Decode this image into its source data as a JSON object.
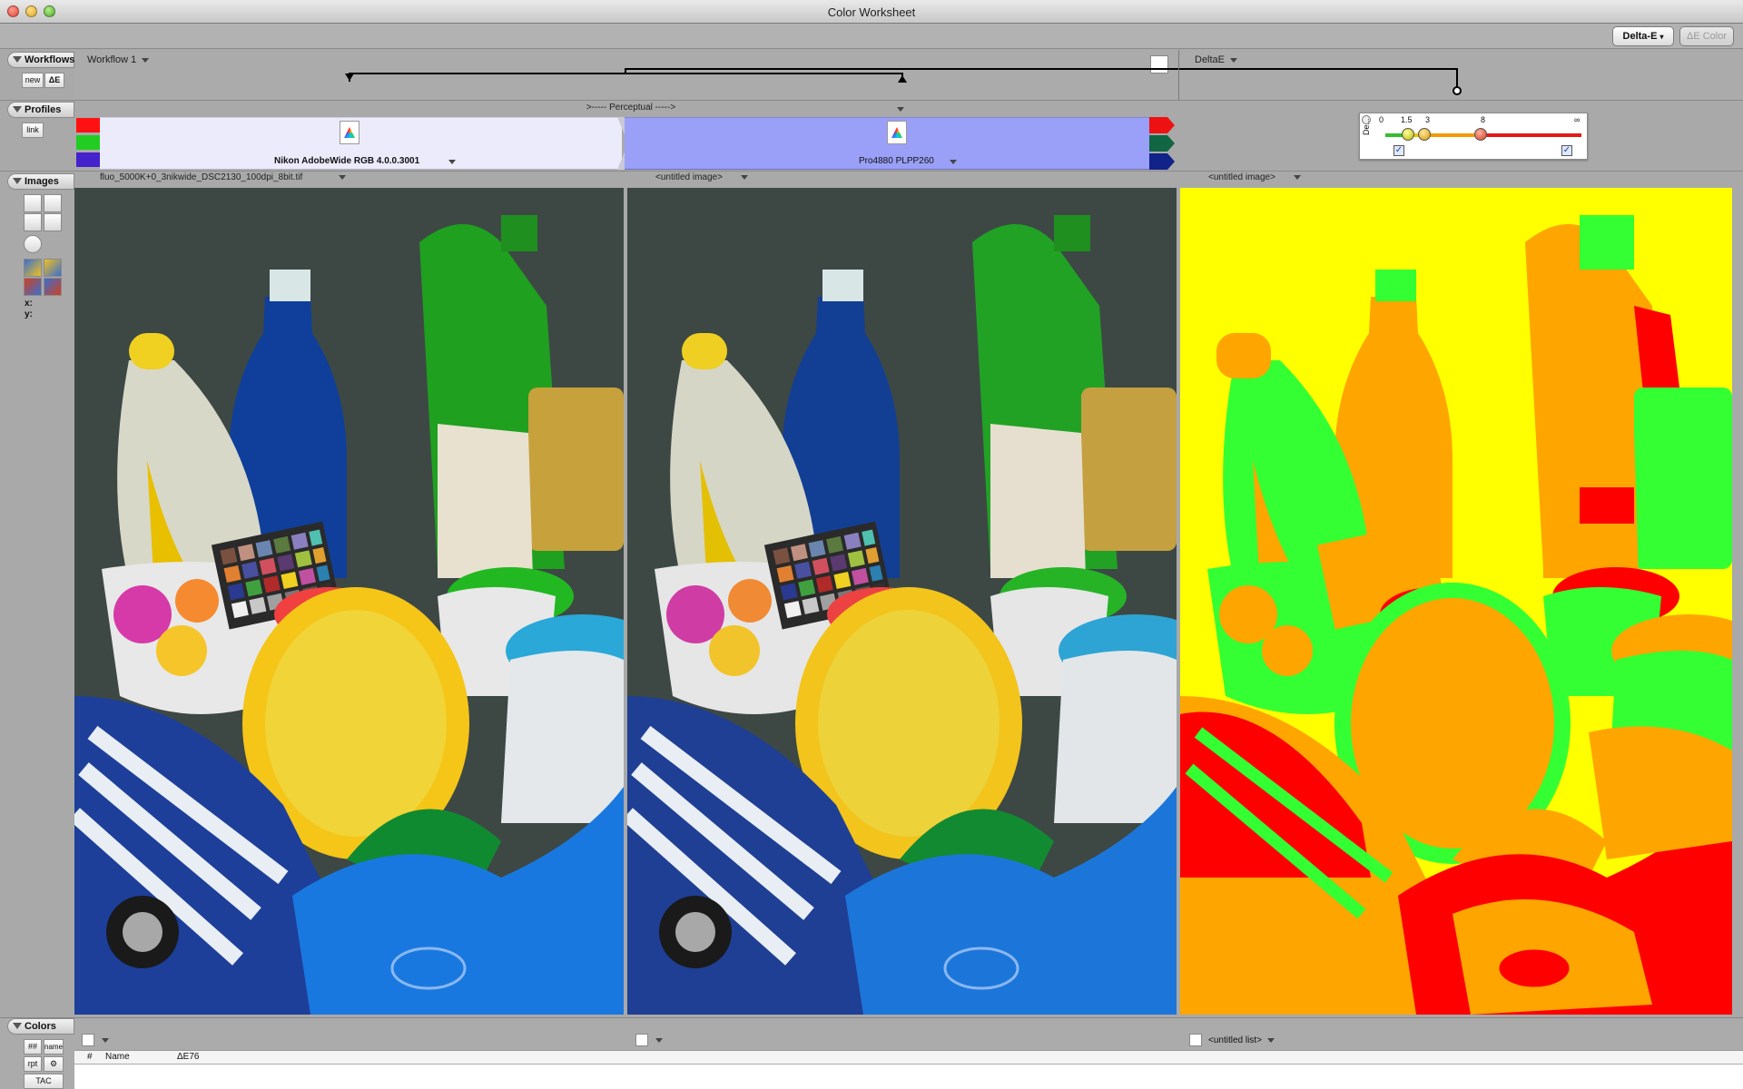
{
  "window": {
    "title": "Color Worksheet"
  },
  "toolbar": {
    "delta_e_label": "Delta-E",
    "delta_e_color_label": "ΔE Color"
  },
  "sections": {
    "workflows": "Workflows",
    "profiles": "Profiles",
    "images": "Images",
    "colors": "Colors"
  },
  "workflows": {
    "new_btn": "new",
    "de_btn": "ΔE",
    "workflow_name": "Workflow 1",
    "right_name": "DeltaE"
  },
  "profiles": {
    "link_btn": "link",
    "intent": ">----- Perceptual ----->",
    "source": "Nikon AdobeWide RGB 4.0.0.3001",
    "dest": "Pro4880 PLPP260"
  },
  "delta_e_widget": {
    "side_label": "De...",
    "ticks": [
      "0",
      "1.5",
      "3",
      "8",
      "∞"
    ],
    "colors": {
      "green": "#2fbf2f",
      "yellow": "#e6c600",
      "orange": "#f59a00",
      "red": "#e31a1a"
    }
  },
  "images": {
    "headers": [
      "fluo_5000K+0_3nikwide_DSC2130_100dpi_8bit.tif",
      "<untitled image>",
      "<untitled image>"
    ],
    "coords": {
      "x": "x:",
      "y": "y:"
    }
  },
  "colors": {
    "buttons": {
      "hash": "##",
      "name": "name",
      "rpt": "rpt",
      "tac": "TAC"
    },
    "list_title": "<untitled list>",
    "columns": [
      "#",
      "Name",
      "ΔE76"
    ]
  }
}
